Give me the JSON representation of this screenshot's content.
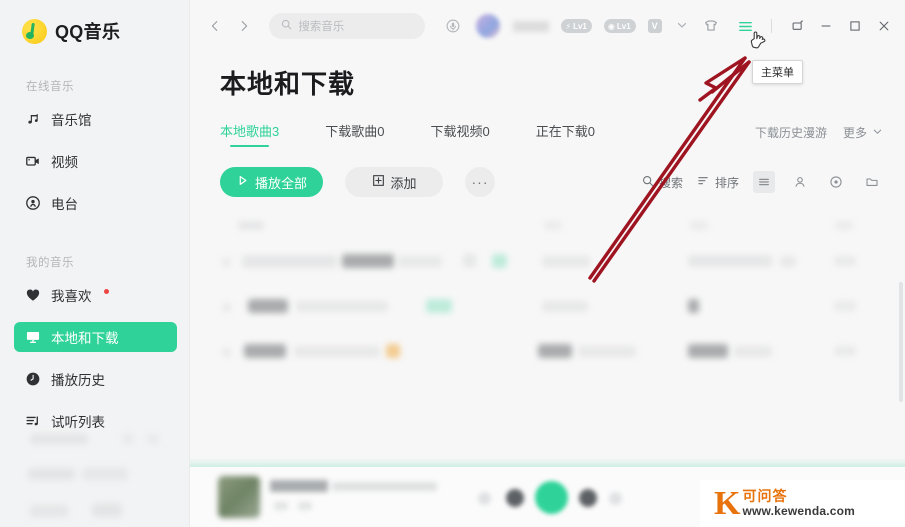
{
  "app": {
    "brand": "QQ音乐",
    "logo_icon": "qq-music-note-icon",
    "accent_color": "#2fd39a",
    "badge_red": "#ee4444",
    "watermark_orange": "#e8720c"
  },
  "sidebar": {
    "groups": [
      {
        "label": "在线音乐",
        "items": [
          {
            "label": "音乐馆",
            "icon": "music-note-icon",
            "active": false
          },
          {
            "label": "视频",
            "icon": "video-camera-icon",
            "active": false
          },
          {
            "label": "电台",
            "icon": "radio-icon",
            "active": false
          }
        ]
      },
      {
        "label": "我的音乐",
        "items": [
          {
            "label": "我喜欢",
            "icon": "heart-icon",
            "active": false,
            "dot": true
          },
          {
            "label": "本地和下载",
            "icon": "monitor-icon",
            "active": true
          },
          {
            "label": "播放历史",
            "icon": "clock-icon",
            "active": false
          },
          {
            "label": "试听列表",
            "icon": "playlist-icon",
            "active": false
          }
        ]
      }
    ]
  },
  "topbar": {
    "back_icon": "chevron-left-icon",
    "forward_icon": "chevron-right-icon",
    "search": {
      "icon": "search-icon",
      "placeholder": "搜索音乐",
      "value": ""
    },
    "mic_icon": "microphone-icon",
    "user": {
      "avatar": "user-avatar",
      "badges": [
        {
          "icon": "lightning-icon",
          "label": "Lv1"
        },
        {
          "icon": "coin-icon",
          "label": "Lv1"
        }
      ],
      "vip_label": "V",
      "chevron_icon": "chevron-down-icon"
    },
    "skin_icon": "skin-shirt-icon",
    "menu_icon": "hamburger-menu-icon",
    "menu_tooltip": "主菜单",
    "window": {
      "mini_icon": "mini-player-icon",
      "minimize_icon": "minimize-icon",
      "maximize_icon": "maximize-icon",
      "close_icon": "close-icon"
    }
  },
  "page": {
    "title": "本地和下载",
    "tabs": [
      {
        "label": "本地歌曲3",
        "active": true
      },
      {
        "label": "下载歌曲0",
        "active": false
      },
      {
        "label": "下载视频0",
        "active": false
      },
      {
        "label": "正在下载0",
        "active": false
      }
    ],
    "tabs_right": {
      "roam_label": "下载历史漫游",
      "more_label": "更多",
      "more_icon": "chevron-down-icon"
    },
    "actions": {
      "play_all": {
        "label": "播放全部",
        "icon": "play-icon"
      },
      "add": {
        "label": "添加",
        "icon": "plus-box-icon"
      },
      "more": {
        "label": "···",
        "icon": "ellipsis-icon"
      }
    },
    "actions_right": {
      "search": {
        "label": "搜索",
        "icon": "search-icon"
      },
      "sort": {
        "label": "排序",
        "icon": "sort-icon"
      },
      "views": [
        {
          "icon": "list-view-icon",
          "selected": true
        },
        {
          "icon": "singer-view-icon",
          "selected": false
        },
        {
          "icon": "album-disc-view-icon",
          "selected": false
        },
        {
          "icon": "folder-view-icon",
          "selected": false
        }
      ]
    },
    "table": {
      "redacted": true,
      "row_count": 3
    }
  },
  "player": {
    "redacted": true,
    "controls": [
      {
        "icon": "shuffle-icon"
      },
      {
        "icon": "previous-icon"
      },
      {
        "icon": "play-icon"
      },
      {
        "icon": "next-icon"
      },
      {
        "icon": "lyrics-icon"
      }
    ]
  },
  "annotation": {
    "arrow_color": "#9e1420",
    "arrow_target": "hamburger-menu-icon"
  },
  "watermark": {
    "logo_letter": "K",
    "name": "可问答",
    "url": "www.kewenda.com"
  }
}
